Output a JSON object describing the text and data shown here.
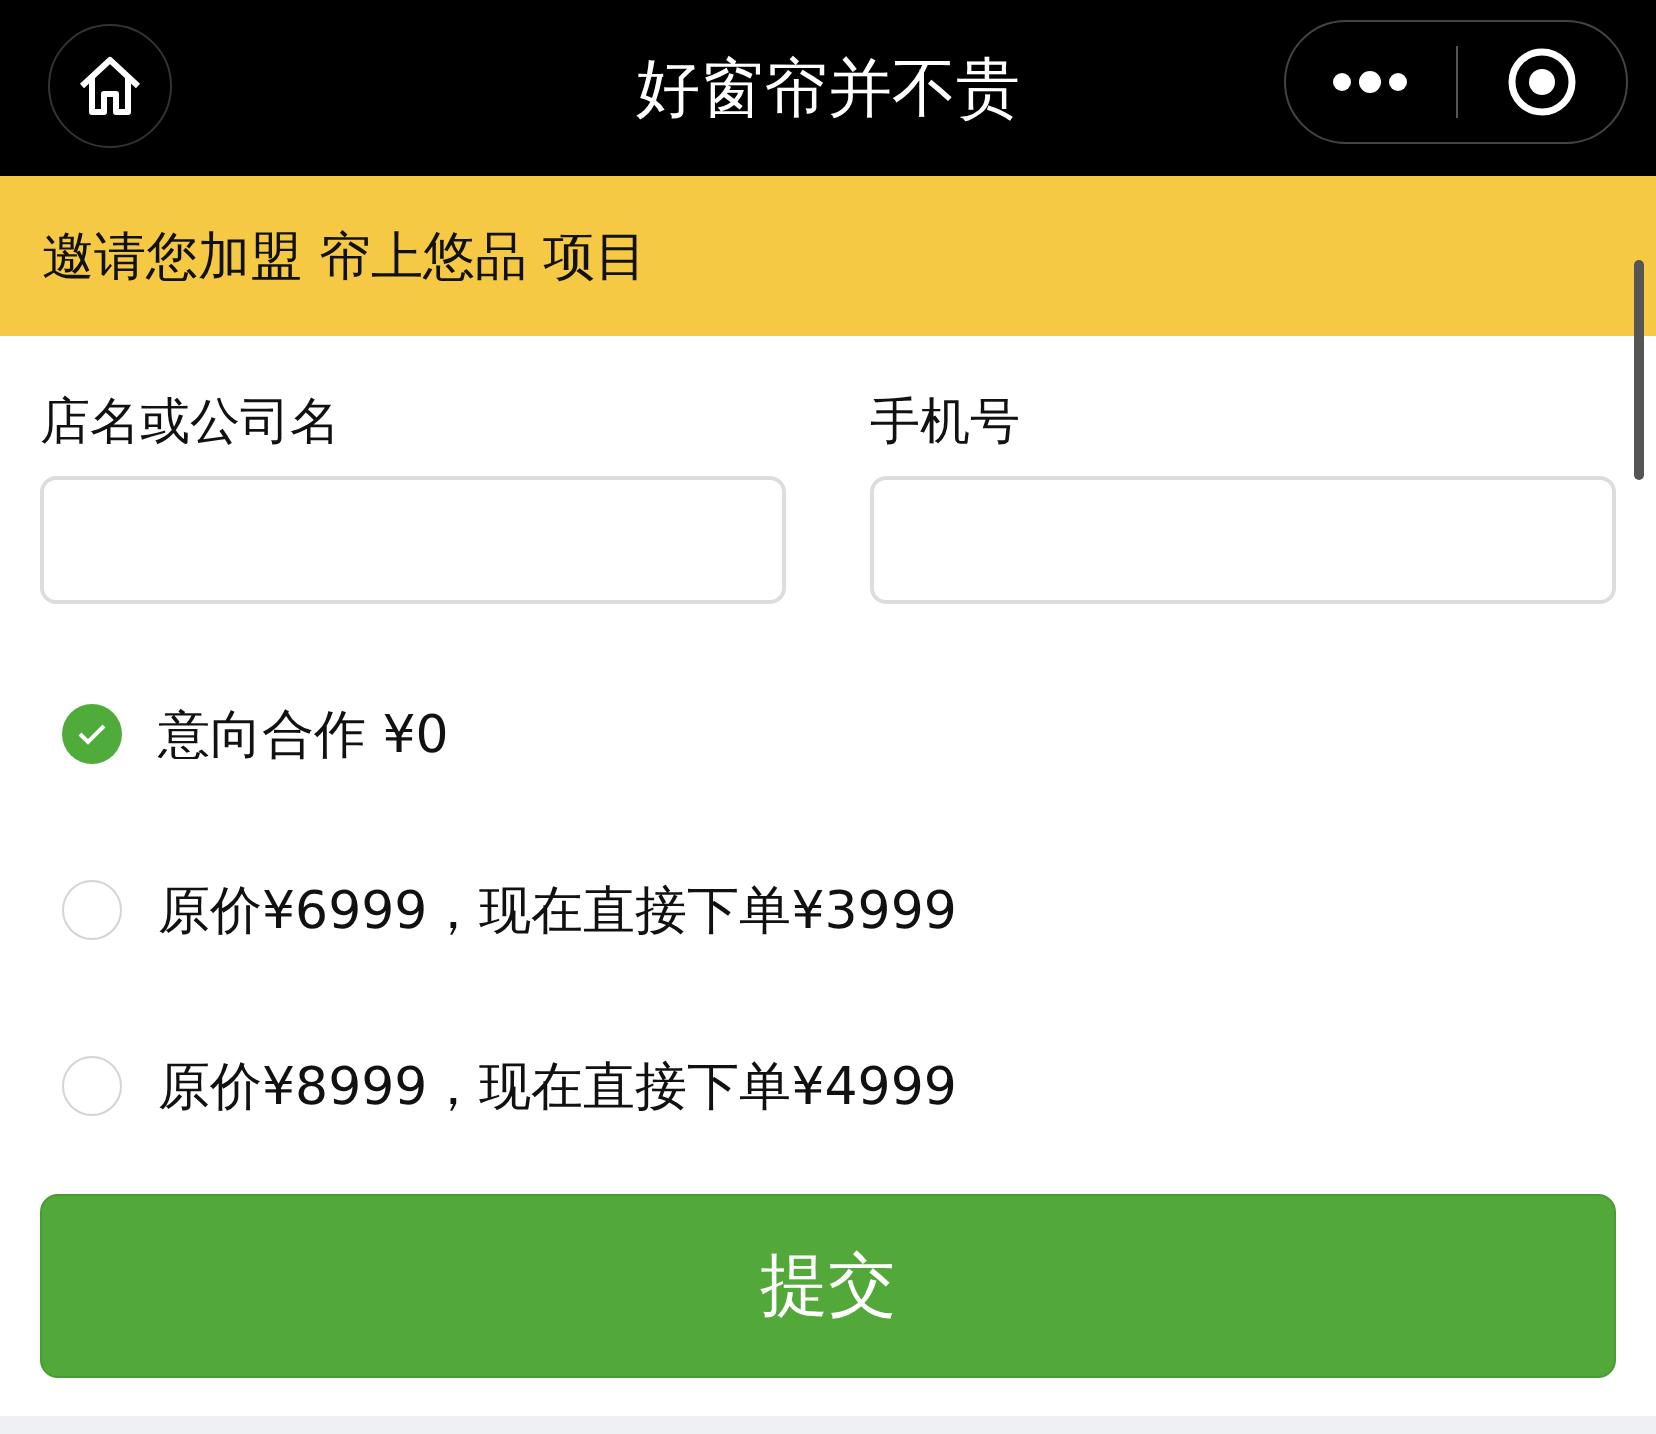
{
  "header": {
    "title": "好窗帘并不贵"
  },
  "banner": {
    "text": "邀请您加盟 帘上悠品 项目"
  },
  "fields": [
    {
      "label": "店名或公司名"
    },
    {
      "label": "手机号"
    }
  ],
  "options": [
    {
      "label": "意向合作 ¥0",
      "selected": true
    },
    {
      "label": "原价¥6999，现在直接下单¥3999",
      "selected": false
    },
    {
      "label": "原价¥8999，现在直接下单¥4999",
      "selected": false
    }
  ],
  "submit": {
    "label": "提交"
  }
}
